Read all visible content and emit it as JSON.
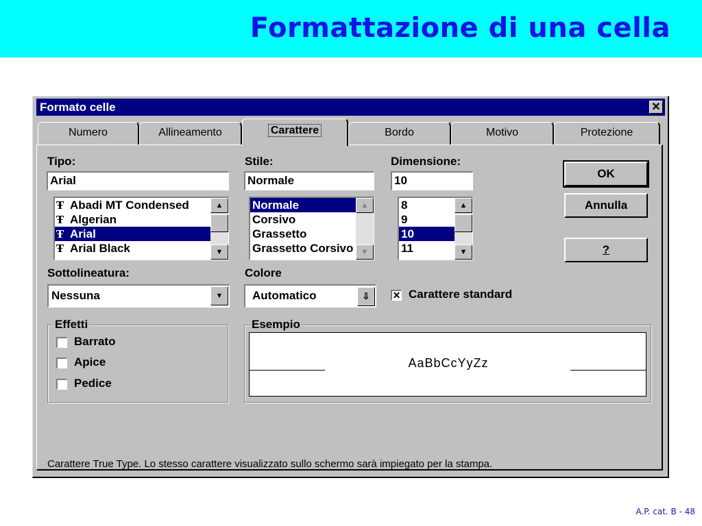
{
  "slide": {
    "title": "Formattazione di una cella",
    "footer": "A.P. cat. B - 48"
  },
  "dialog": {
    "title": "Formato celle",
    "close_glyph": "✕",
    "tabs": [
      "Numero",
      "Allineamento",
      "Carattere",
      "Bordo",
      "Motivo",
      "Protezione"
    ],
    "active_tab": "Carattere",
    "tipo": {
      "label": "Tipo:",
      "value": "Arial",
      "items": [
        "Abadi MT Condensed",
        "Algerian",
        "Arial",
        "Arial Black"
      ],
      "selected": "Arial",
      "item_icon": "truetype-icon"
    },
    "stile": {
      "label": "Stile:",
      "value": "Normale",
      "items": [
        "Normale",
        "Corsivo",
        "Grassetto",
        "Grassetto Corsivo"
      ],
      "selected": "Normale"
    },
    "dimensione": {
      "label": "Dimensione:",
      "value": "10",
      "items": [
        "8",
        "9",
        "10",
        "11"
      ],
      "selected": "10"
    },
    "buttons": {
      "ok": "OK",
      "annulla": "Annulla",
      "help": "?"
    },
    "sottolineatura": {
      "label": "Sottolineatura:",
      "value": "Nessuna"
    },
    "colore": {
      "label": "Colore",
      "value": "Automatico"
    },
    "carattere_standard": {
      "label": "Carattere standard",
      "checked": true
    },
    "effetti": {
      "title": "Effetti",
      "items": [
        {
          "label": "Barrato",
          "checked": false
        },
        {
          "label": "Apice",
          "checked": false
        },
        {
          "label": "Pedice",
          "checked": false
        }
      ]
    },
    "esempio": {
      "title": "Esempio",
      "sample": "AaBbCcYyZz"
    },
    "status": "Carattere True Type. Lo stesso carattere visualizzato sullo schermo sarà impiegato per la stampa."
  },
  "colors": {
    "banner": "#00ffff",
    "title_text": "#1414e6",
    "titlebar": "#000080",
    "dialog_face": "#c0c0c0",
    "selection": "#000080"
  }
}
